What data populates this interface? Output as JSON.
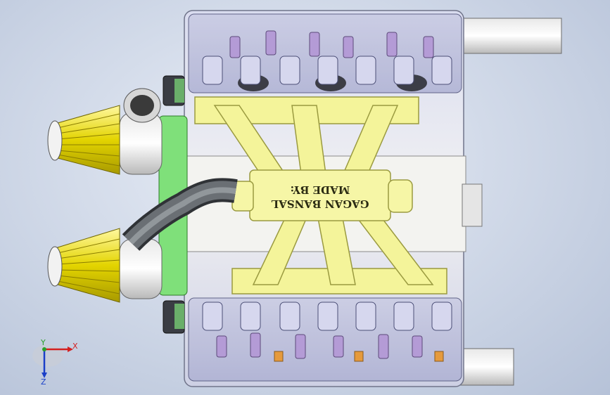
{
  "watermark": {
    "line1": "GAGAN BANSAL",
    "line2": "MADE BY:"
  },
  "triad": {
    "x_label": "X",
    "y_label": "Y",
    "z_label": "Z"
  },
  "colors": {
    "manifold": "#f4f49a",
    "air_filter": "#e3d400",
    "gear_plate": "#7fe07a",
    "intake_pipe": "#5a5f63",
    "triad_x": "#d42020",
    "triad_y": "#2aa02a",
    "triad_z": "#1a3fc8"
  }
}
